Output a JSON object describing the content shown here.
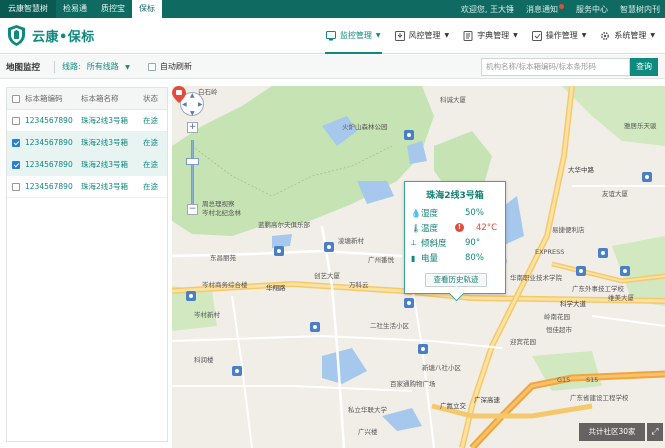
{
  "topbar": {
    "tabs": [
      {
        "label": "云康智慧树"
      },
      {
        "label": "检易通"
      },
      {
        "label": "质控宝"
      },
      {
        "label": "保标"
      }
    ],
    "welcome": "欢迎您, 王大锤",
    "messages": "消息通知",
    "service": "服务中心",
    "brand_link": "智慧树内刊"
  },
  "header": {
    "logo_text": "云康•保标",
    "nav": [
      {
        "label": "监控管理",
        "icon": "monitor-icon"
      },
      {
        "label": "风控管理",
        "icon": "risk-icon"
      },
      {
        "label": "字典管理",
        "icon": "dictionary-icon"
      },
      {
        "label": "操作管理",
        "icon": "operation-icon"
      },
      {
        "label": "系统管理",
        "icon": "gear-icon"
      }
    ]
  },
  "toolbar": {
    "title": "地图监控",
    "route_label": "线路:",
    "route_value": "所有线路",
    "auto_refresh": "自动刷新",
    "search_placeholder": "机构名称/标本箱编码/标本条形码",
    "search_button": "查询"
  },
  "table": {
    "headers": [
      "标本箱编码",
      "标本箱名称",
      "状态"
    ],
    "rows": [
      {
        "code": "1234567890",
        "name": "珠海2线3号箱",
        "status": "在途",
        "checked": false
      },
      {
        "code": "1234567890",
        "name": "珠海2线3号箱",
        "status": "在途",
        "checked": true
      },
      {
        "code": "1234567890",
        "name": "珠海2线3号箱",
        "status": "在途",
        "checked": true
      },
      {
        "code": "1234567890",
        "name": "珠海2线3号箱",
        "status": "在途",
        "checked": false
      }
    ]
  },
  "popup": {
    "title": "珠海2线3号箱",
    "rows": [
      {
        "label": "湿度",
        "value": "50%",
        "icon": "droplet-icon"
      },
      {
        "label": "温度",
        "value": "42°C",
        "icon": "thermometer-icon",
        "warning": true
      },
      {
        "label": "倾斜度",
        "value": "90°",
        "icon": "tilt-icon"
      },
      {
        "label": "电量",
        "value": "80%",
        "icon": "battery-icon"
      }
    ],
    "button": "查看历史轨迹"
  },
  "map": {
    "count_text": "共计社区30家",
    "labels": {
      "baiyunshan": "白石岭",
      "kecheng": "科诚大厦",
      "huoluoshan": "火炉山森林公园",
      "zhoudong": "周总理视察",
      "cunbei": "岑村北纪念林",
      "lantian": "蓝鹏高尔夫俱乐部",
      "lingjian": "凌塘新村",
      "dongfeng": "东昌丽苑",
      "guangzhou_mu": "广州番悦",
      "cunshang": "岑村商务综合楼",
      "chuangyi": "创艺大厦",
      "huajing": "华翔路",
      "wanli": "万科云",
      "er": "二社生活小区",
      "xinyuan": "新塘八社小区",
      "cunnan": "岑村新村",
      "kerun": "科润楼",
      "baijia": "百家通购物广场",
      "guangqi": "广氮立交",
      "guangshen": "广深高速",
      "sihua": "私立华联大学",
      "guangxing": "广兴楼",
      "kexue": "科学大道",
      "express": "EXPRESS",
      "yiqing": "易捷便利店",
      "huanan": "华南职业技术学院",
      "guangdong_she": "广东外事技工学校",
      "guangdong_jian": "广东省建设工程学校",
      "yaxing": "雅居乐天骏",
      "youshi": "友谊大厦",
      "henglan": "恒佳超市",
      "yingjin": "迎宾花园",
      "guangzhou_st": "广东省外事岭南花园",
      "weimei": "维美大厦",
      "lingnan": "岭南花园",
      "dahua": "大华中路",
      "g15": "G15",
      "s15": "S15"
    }
  },
  "colors": {
    "primary": "#0f8a7e",
    "topbar": "#0f6a61",
    "warning": "#e54b3c",
    "checkbox": "#2a7fd4"
  }
}
